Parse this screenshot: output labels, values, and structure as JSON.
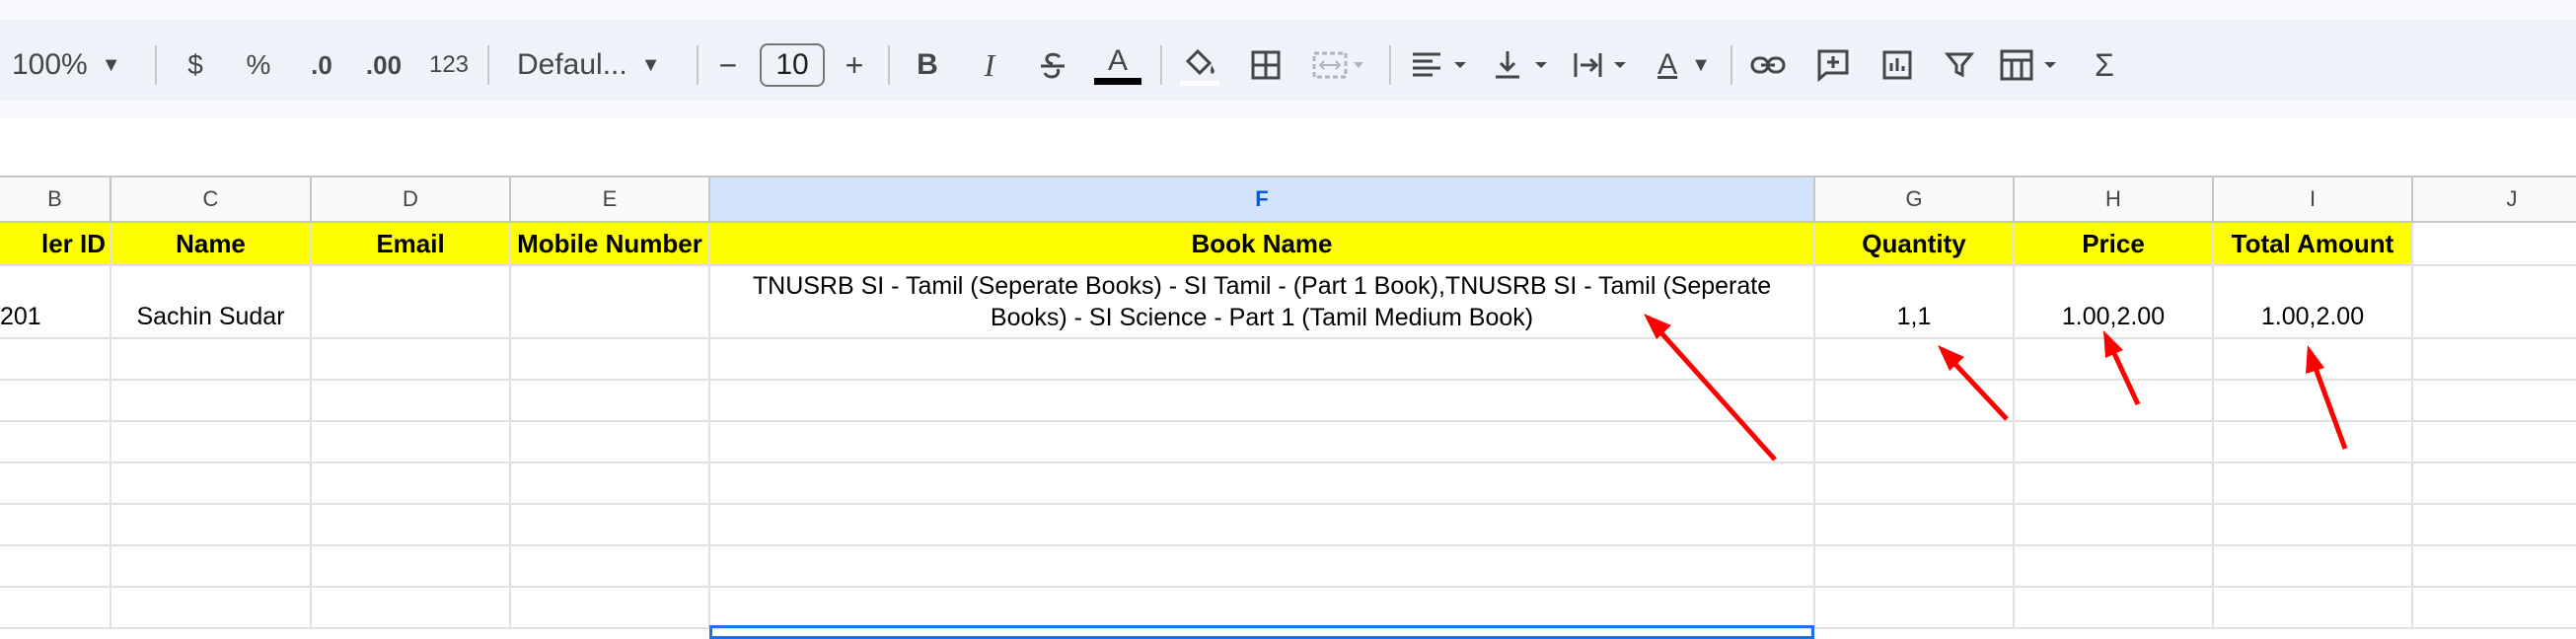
{
  "toolbar": {
    "zoom": "100%",
    "currency": "$",
    "percent": "%",
    "decrease_decimal": ".0",
    "increase_decimal": ".00",
    "number_format": "123",
    "font": "Defaul...",
    "font_size": "10",
    "minus": "−",
    "plus": "+",
    "bold": "B",
    "italic": "I",
    "text_color_letter": "A",
    "text_rotation_letter": "A",
    "sigma": "Σ"
  },
  "columns": [
    "B",
    "C",
    "D",
    "E",
    "F",
    "G",
    "H",
    "I",
    "J"
  ],
  "selected_column": "F",
  "header_row": {
    "order_id": "ler ID",
    "name": "Name",
    "email": "Email",
    "mobile": "Mobile Number",
    "book_name": "Book Name",
    "quantity": "Quantity",
    "price": "Price",
    "total_amount": "Total Amount"
  },
  "data_row": {
    "order_id": "201",
    "name": "Sachin Sudar",
    "email": "",
    "mobile": "",
    "book_name": "TNUSRB SI - Tamil (Seperate Books) - SI Tamil - (Part 1 Book),TNUSRB SI - Tamil (Seperate Books) - SI Science - Part 1 (Tamil Medium Book)",
    "quantity": "1,1",
    "price": "1.00,2.00",
    "total_amount": "1.00,2.00"
  },
  "colors": {
    "header_fill": "#ffff00",
    "annotation_arrow": "#ff0000",
    "selection": "#1a73e8",
    "selected_column_header": "#d3e3fd"
  }
}
